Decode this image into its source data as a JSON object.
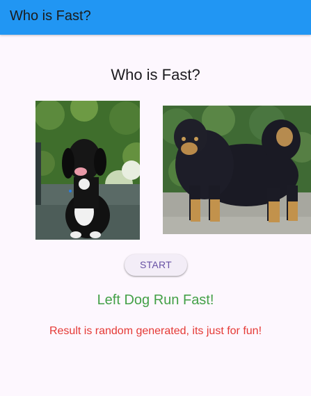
{
  "appbar": {
    "title": "Who is Fast?",
    "color": "#2196f3"
  },
  "main": {
    "heading": "Who is Fast?",
    "left_dog_image": "dog-photo-left",
    "right_dog_image": "dog-photo-right",
    "start_button_label": "START",
    "result": "Left Dog Run Fast!",
    "result_color": "#43a047",
    "disclaimer": "Result is random generated, its just for fun!",
    "disclaimer_color": "#e53935"
  }
}
